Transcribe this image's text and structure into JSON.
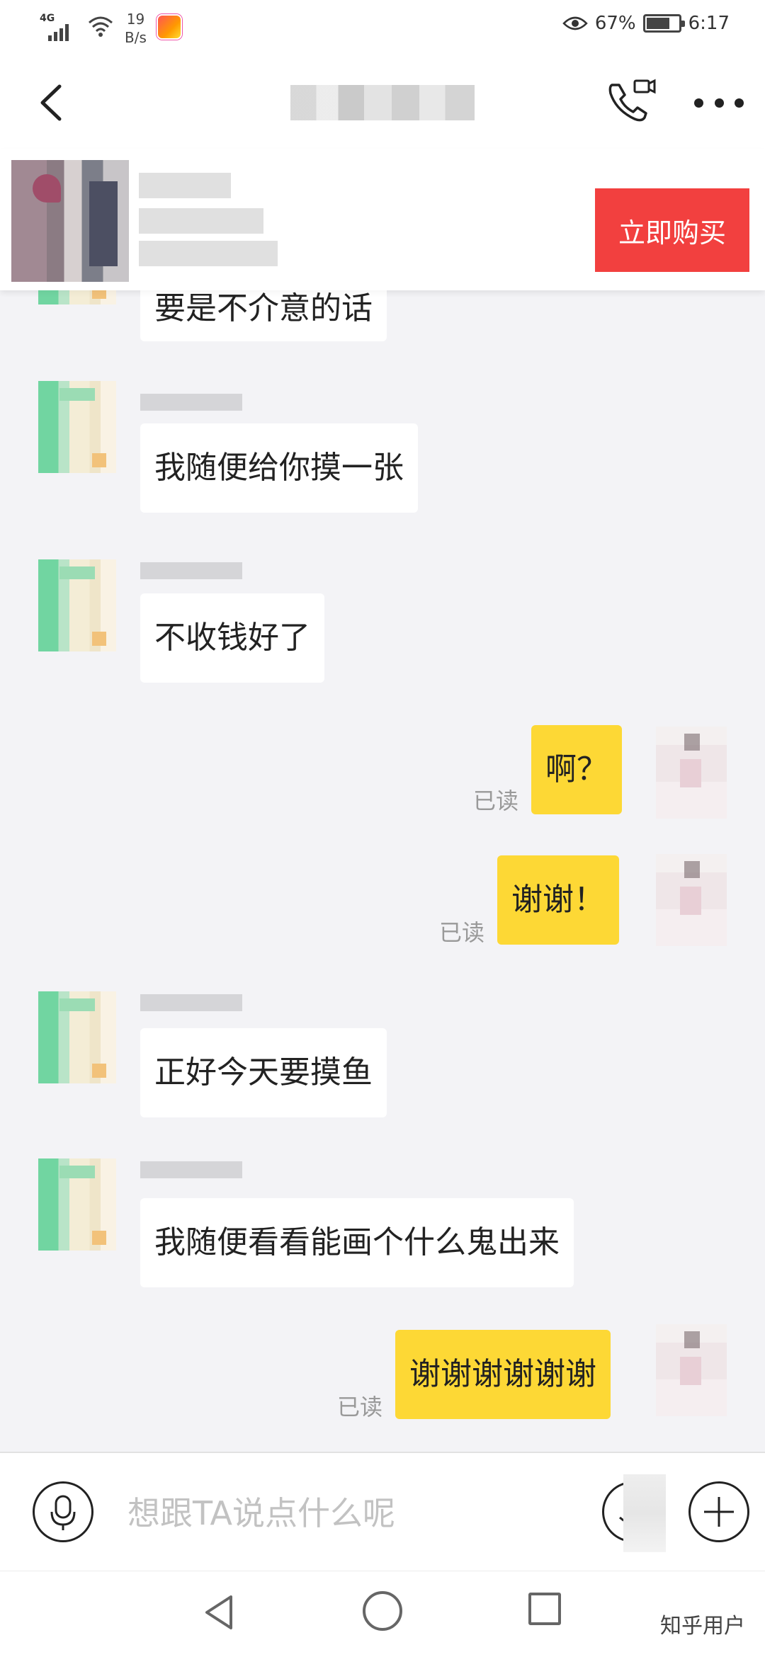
{
  "status_bar": {
    "network": "4G",
    "speed_value": "19",
    "speed_unit": "B/s",
    "battery_percent": "67%",
    "battery_level": 0.67,
    "time": "6:17"
  },
  "product": {
    "buy_label": "立即购买",
    "accent_color": "#f2403f"
  },
  "messages": [
    {
      "side": "in",
      "text": "要是不介意的话"
    },
    {
      "side": "in",
      "text": "我随便给你摸一张"
    },
    {
      "side": "in",
      "text": "不收钱好了"
    },
    {
      "side": "out",
      "text": "啊？",
      "status": "已读"
    },
    {
      "side": "out",
      "text": "谢谢！",
      "status": "已读"
    },
    {
      "side": "in",
      "text": "正好今天要摸鱼"
    },
    {
      "side": "in",
      "text": "我随便看看能画个什么鬼出来"
    },
    {
      "side": "out",
      "text": "谢谢谢谢谢谢",
      "status": "已读"
    }
  ],
  "input": {
    "placeholder": "想跟TA说点什么呢"
  },
  "watermark": "知乎用户",
  "colors": {
    "outgoing_bubble": "#fdd835",
    "incoming_bubble": "#ffffff",
    "chat_background": "#f3f3f6"
  }
}
